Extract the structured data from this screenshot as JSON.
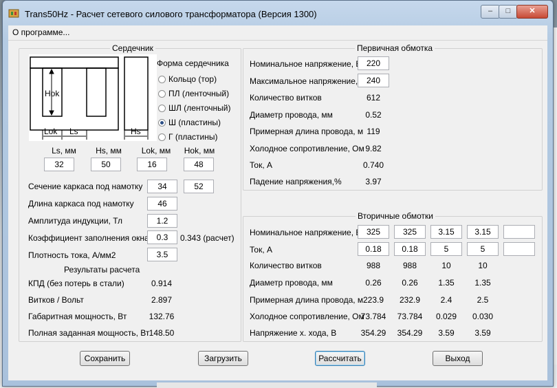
{
  "window": {
    "title": "Trans50Hz - Расчет сетевого силового трансформатора (Версия 1300)"
  },
  "menu": {
    "about": "О программе..."
  },
  "core": {
    "group_title": "Сердечник",
    "shape_title": "Форма сердечника",
    "shapes": [
      {
        "label": "Кольцо  (тор)",
        "selected": false
      },
      {
        "label": "ПЛ  (ленточный)",
        "selected": false
      },
      {
        "label": "ШЛ  (ленточный)",
        "selected": false
      },
      {
        "label": "Ш  (пластины)",
        "selected": true
      },
      {
        "label": "Г (пластины)",
        "selected": false
      }
    ],
    "drawing": {
      "hok": "Hok",
      "lok": "Lok",
      "ls": "Ls",
      "hs": "Hs"
    },
    "dims": [
      {
        "label": "Ls, мм",
        "value": "32"
      },
      {
        "label": "Hs, мм",
        "value": "50"
      },
      {
        "label": "Lok, мм",
        "value": "16"
      },
      {
        "label": "Hok, мм",
        "value": "48"
      }
    ],
    "params": {
      "section_label": "Сечение каркаса под намотку",
      "section_a": "34",
      "section_b": "52",
      "length_label": "Длина каркаса под намотку",
      "length": "46",
      "induction_label": "Амплитуда индукции, Тл",
      "induction": "1.2",
      "fill_label": "Коэффициент заполнения окна",
      "fill": "0.3",
      "fill_calc": "0.343 (расчет)",
      "density_label": "Плотность тока, А/мм2",
      "density": "3.5"
    }
  },
  "results": {
    "title": "Результаты расчета",
    "rows": [
      {
        "label": "КПД (без потерь в стали)",
        "value": "0.914"
      },
      {
        "label": "Витков / Вольт",
        "value": "2.897"
      },
      {
        "label": "Габаритная мощность, Вт",
        "value": "132.76"
      },
      {
        "label": "Полная заданная мощность, Вт",
        "value": "148.50"
      }
    ]
  },
  "primary": {
    "title": "Первичная обмотка",
    "rows": [
      {
        "label": "Номинальное напряжение, В",
        "value": "220"
      },
      {
        "label": "Максимальное напряжение, В",
        "value": "240"
      },
      {
        "label": "Количество витков",
        "value": "612"
      },
      {
        "label": "Диаметр провода, мм",
        "value": "0.52"
      },
      {
        "label": "Примерная длина провода, м",
        "value": "119"
      },
      {
        "label": "Холодное сопротивление, Ом",
        "value": "9.82"
      },
      {
        "label": "Ток, А",
        "value": "0.740"
      },
      {
        "label": "Падение напряжения,%",
        "value": "3.97"
      }
    ]
  },
  "secondary": {
    "title": "Вторичные обмотки",
    "rows": [
      {
        "label": "Номинальное напряжение, В",
        "values": [
          "325",
          "325",
          "3.15",
          "3.15",
          ""
        ]
      },
      {
        "label": "Ток, А",
        "values": [
          "0.18",
          "0.18",
          "5",
          "5",
          ""
        ]
      },
      {
        "label": "Количество витков",
        "values": [
          "988",
          "988",
          "10",
          "10"
        ]
      },
      {
        "label": "Диаметр провода, мм",
        "values": [
          "0.26",
          "0.26",
          "1.35",
          "1.35"
        ]
      },
      {
        "label": "Примерная длина провода, м",
        "values": [
          "223.9",
          "232.9",
          "2.4",
          "2.5"
        ]
      },
      {
        "label": "Холодное сопротивление, Ом",
        "values": [
          "73.784",
          "73.784",
          "0.029",
          "0.030"
        ]
      },
      {
        "label": "Напряжение х. хода, В",
        "values": [
          "354.29",
          "354.29",
          "3.59",
          "3.59"
        ]
      }
    ]
  },
  "buttons": {
    "save": "Сохранить",
    "load": "Загрузить",
    "calc": "Рассчитать",
    "exit": "Выход"
  }
}
